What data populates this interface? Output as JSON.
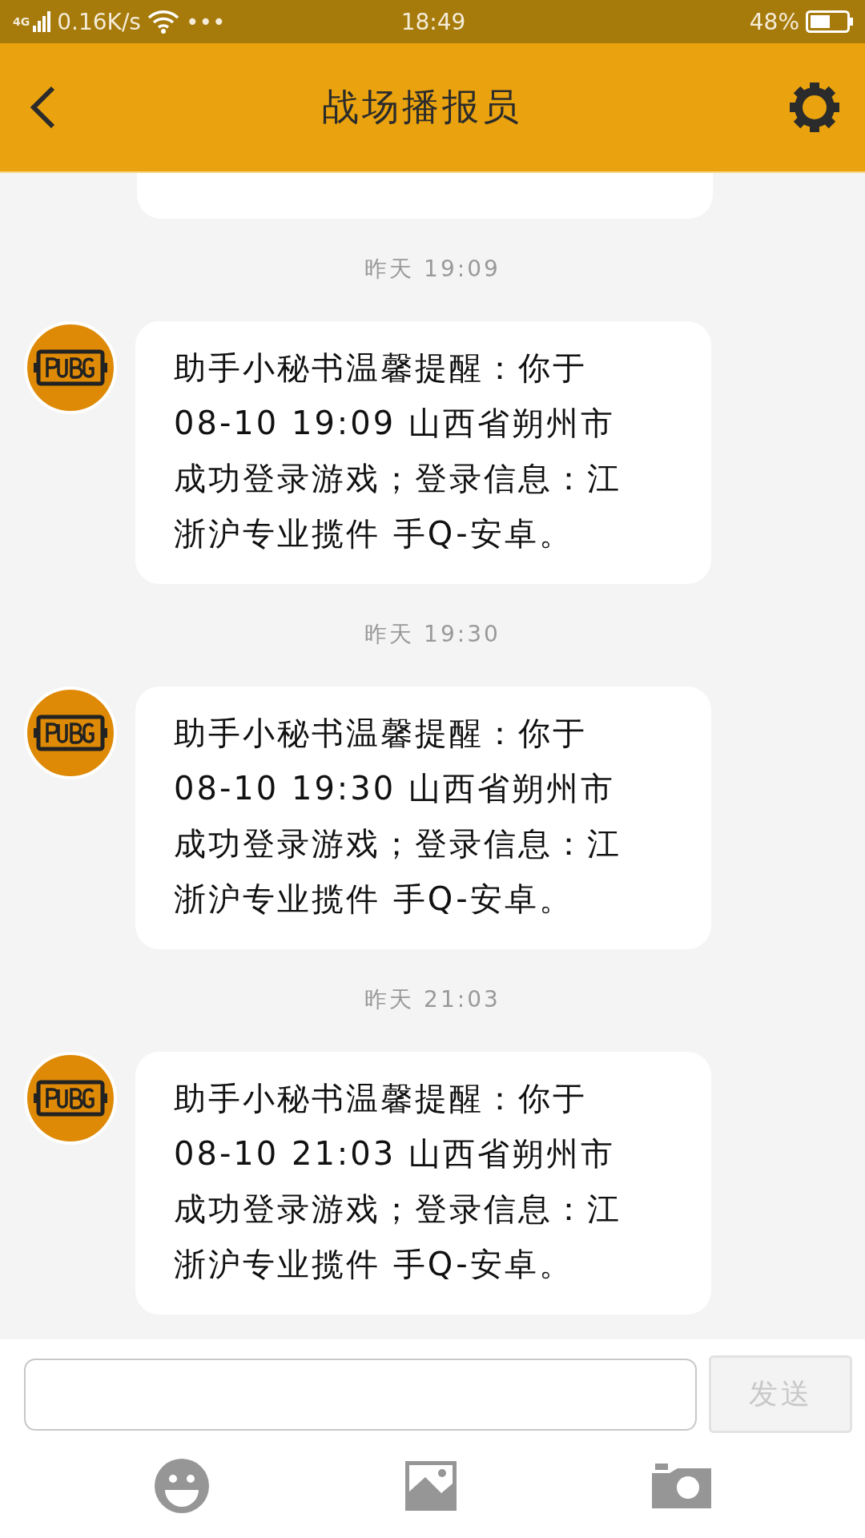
{
  "status_bar": {
    "network": "4G",
    "speed": "0.16K/s",
    "more": "•••",
    "time": "18:49",
    "battery_text": "48%"
  },
  "header": {
    "title": "战场播报员"
  },
  "messages": [
    {
      "time": "昨天 19:09",
      "text": "助手小秘书温馨提醒：你于08-10 19:09 山西省朔州市成功登录游戏；登录信息：江浙沪专业揽件 手Q-安卓。"
    },
    {
      "time": "昨天 19:30",
      "text": "助手小秘书温馨提醒：你于08-10 19:30 山西省朔州市成功登录游戏；登录信息：江浙沪专业揽件 手Q-安卓。"
    },
    {
      "time": "昨天 21:03",
      "text": "助手小秘书温馨提醒：你于08-10 21:03 山西省朔州市成功登录游戏；登录信息：江浙沪专业揽件 手Q-安卓。"
    }
  ],
  "composer": {
    "send_label": "发送",
    "send_disabled": true
  }
}
